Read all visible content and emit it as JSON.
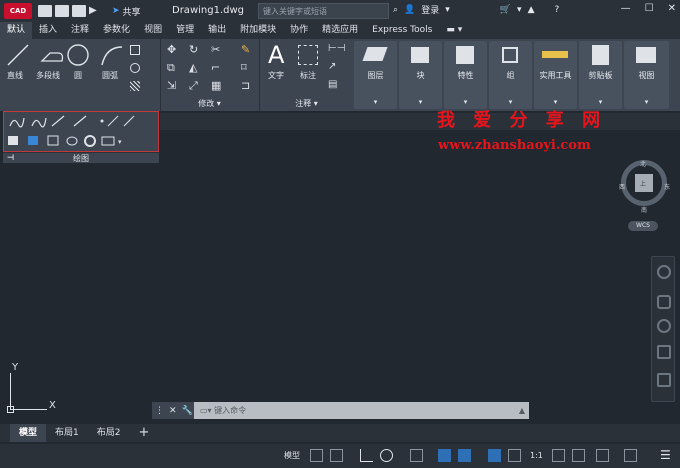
{
  "titlebar": {
    "logo": "CAD",
    "share_label": "共享",
    "document": "Drawing1.dwg",
    "search_placeholder": "键入关键字或短语",
    "login_label": "登录"
  },
  "tabs": [
    "默认",
    "插入",
    "注释",
    "参数化",
    "视图",
    "管理",
    "输出",
    "附加模块",
    "协作",
    "精选应用",
    "Express Tools"
  ],
  "ribbon": {
    "draw": {
      "line": "直线",
      "polyline": "多段线",
      "circle": "圆",
      "arc": "圆弧"
    },
    "modify_title": "修改",
    "annotation": {
      "text": "文字",
      "dimension": "标注",
      "title": "注释"
    },
    "big_buttons": [
      "图层",
      "块",
      "特性",
      "组",
      "实用工具",
      "剪贴板",
      "视图"
    ]
  },
  "draw_panel_title": "绘图",
  "watermark": {
    "line1": "我 爱 分 享 网",
    "line2": "www.zhanshaoyi.com"
  },
  "viewcube": {
    "north": "北",
    "south": "南",
    "west": "西",
    "east": "东",
    "top": "上",
    "wcs": "WCS"
  },
  "ucs": {
    "x": "X",
    "y": "Y"
  },
  "command": {
    "placeholder": "键入命令"
  },
  "layout_tabs": [
    "模型",
    "布局1",
    "布局2"
  ],
  "status": {
    "model": "模型",
    "scale": "1:1"
  },
  "colors": {
    "accent": "#2f6fb6",
    "watermark": "#e8141c",
    "highlight_border": "#c0393b"
  }
}
